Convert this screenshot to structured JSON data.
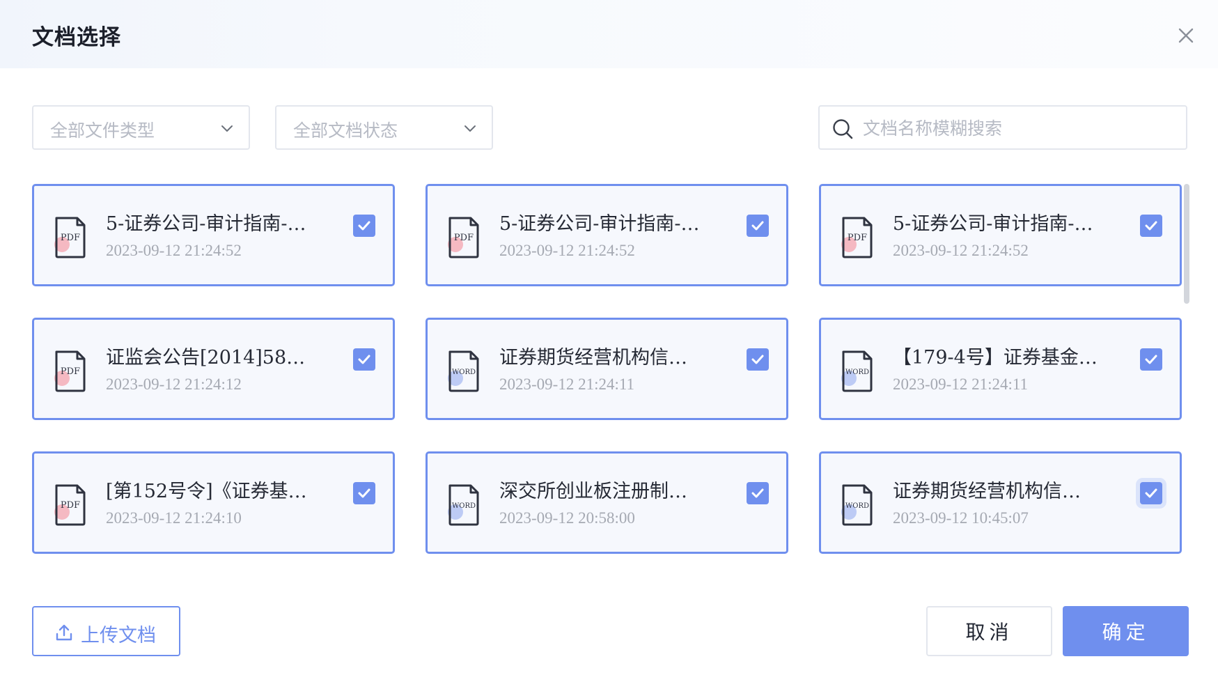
{
  "dialog": {
    "title": "文档选择",
    "close_icon": "close-icon"
  },
  "filters": {
    "file_type_placeholder": "全部文件类型",
    "doc_status_placeholder": "全部文档状态",
    "search_placeholder": "文档名称模糊搜索"
  },
  "colors": {
    "accent": "#6f8fee",
    "pdf_badge": "#f4a4ad",
    "word_badge": "#a9bcf2"
  },
  "documents": [
    {
      "name": "5-证券公司-审计指南-…",
      "time": "2023-09-12 21:24:52",
      "type": "PDF",
      "checked": true
    },
    {
      "name": "5-证券公司-审计指南-…",
      "time": "2023-09-12 21:24:52",
      "type": "PDF",
      "checked": true
    },
    {
      "name": "5-证券公司-审计指南-…",
      "time": "2023-09-12 21:24:52",
      "type": "PDF",
      "checked": true
    },
    {
      "name": "证监会公告[2014]58号…",
      "time": "2023-09-12 21:24:12",
      "type": "PDF",
      "checked": true
    },
    {
      "name": "证券期货经营机构信…",
      "time": "2023-09-12 21:24:11",
      "type": "WORD",
      "checked": true
    },
    {
      "name": "【179-4号】证券基金…",
      "time": "2023-09-12 21:24:11",
      "type": "WORD",
      "checked": true
    },
    {
      "name": "[第152号令]《证券基…",
      "time": "2023-09-12 21:24:10",
      "type": "PDF",
      "checked": true
    },
    {
      "name": "深交所创业板注册制…",
      "time": "2023-09-12 20:58:00",
      "type": "WORD",
      "checked": true
    },
    {
      "name": "证券期货经营机构信…",
      "time": "2023-09-12 10:45:07",
      "type": "WORD",
      "checked": true,
      "focused": true
    }
  ],
  "footer": {
    "upload_label": "上传文档",
    "cancel_label": "取消",
    "confirm_label": "确定"
  }
}
